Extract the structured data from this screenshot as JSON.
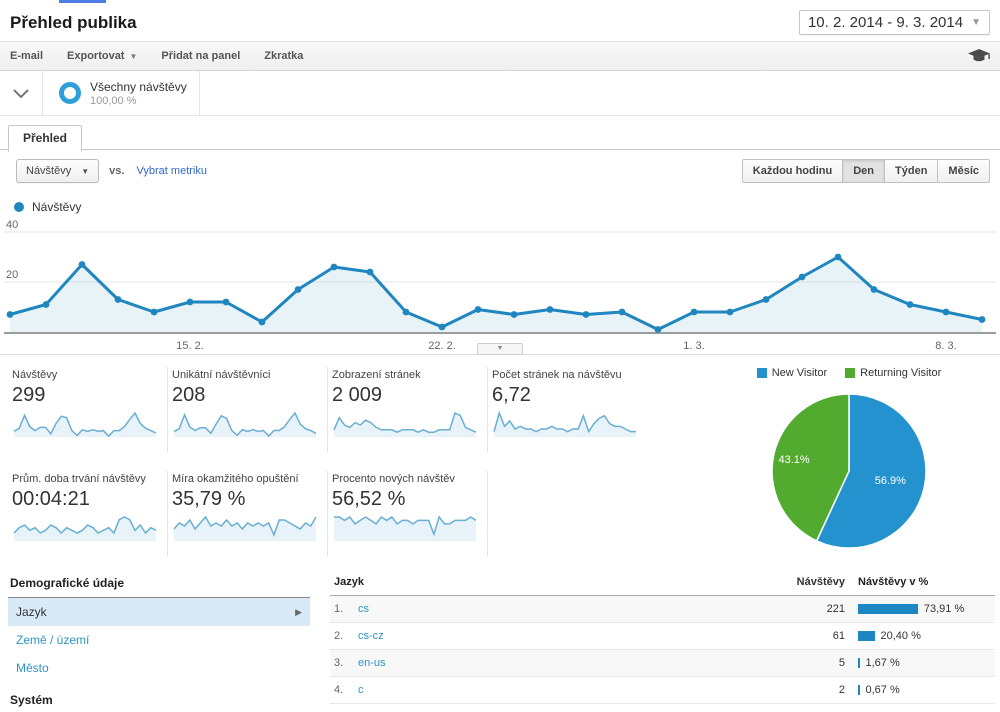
{
  "header": {
    "title": "Přehled publika",
    "date_range": "10. 2. 2014 - 9. 3. 2014"
  },
  "toolbar": {
    "items": [
      "E-mail",
      "Exportovat",
      "Přidat na panel",
      "Zkratka"
    ]
  },
  "segment": {
    "name": "Všechny návštěvy",
    "percent": "100,00 %"
  },
  "tabs": {
    "active": "Přehled"
  },
  "controls": {
    "metric_dropdown": "Návštěvy",
    "vs_label": "vs.",
    "select_metric": "Vybrat metriku",
    "granularity": [
      "Každou hodinu",
      "Den",
      "Týden",
      "Měsíc"
    ],
    "granularity_active": "Den"
  },
  "chart_data": {
    "type": "line",
    "title": "Návštěvy",
    "legend": "Návštěvy",
    "color": "#2086bf",
    "fill": "rgba(32,134,191,0.10)",
    "x": [
      "10.2.",
      "11.2.",
      "12.2.",
      "13.2.",
      "14.2.",
      "15.2.",
      "16.2.",
      "17.2.",
      "18.2.",
      "19.2.",
      "20.2.",
      "21.2.",
      "22.2.",
      "23.2.",
      "24.2.",
      "25.2.",
      "26.2.",
      "27.2.",
      "28.2.",
      "1.3.",
      "2.3.",
      "3.3.",
      "4.3.",
      "5.3.",
      "6.3.",
      "7.3.",
      "8.3.",
      "9.3."
    ],
    "values": [
      7,
      11,
      27,
      13,
      8,
      12,
      12,
      4,
      17,
      26,
      24,
      8,
      2,
      9,
      7,
      9,
      7,
      8,
      1,
      8,
      8,
      13,
      22,
      30,
      17,
      11,
      8,
      5
    ],
    "ylim": [
      0,
      44
    ],
    "y_gridlines": [
      20,
      40
    ],
    "x_tick_labels": [
      "15. 2.",
      "22. 2.",
      "1. 3.",
      "8. 3."
    ],
    "x_tick_indices": [
      5,
      12,
      19,
      26
    ],
    "grid": true,
    "legend_position": "top-left"
  },
  "cards": [
    {
      "label": "Návštěvy",
      "value": "299",
      "spark": [
        7,
        11,
        27,
        13,
        8,
        12,
        12,
        4,
        17,
        26,
        24,
        8,
        2,
        9,
        7,
        9,
        7,
        8,
        1,
        8,
        8,
        13,
        22,
        30,
        17,
        11,
        8,
        5
      ]
    },
    {
      "label": "Unikátní návštěvníci",
      "value": "208",
      "spark": [
        6,
        9,
        24,
        11,
        7,
        10,
        10,
        4,
        14,
        23,
        20,
        7,
        2,
        8,
        6,
        8,
        6,
        7,
        1,
        7,
        7,
        11,
        19,
        26,
        14,
        9,
        7,
        4
      ]
    },
    {
      "label": "Zobrazení stránek",
      "value": "2 009",
      "spark": [
        3,
        8,
        5,
        4,
        6,
        5,
        7,
        6,
        4,
        3,
        3,
        3,
        2,
        3,
        3,
        3,
        2,
        3,
        2,
        2,
        3,
        3,
        3,
        10,
        9,
        4,
        3,
        2
      ]
    },
    {
      "label": "Počet stránek na návštěvu",
      "value": "6,72",
      "spark": [
        2,
        9,
        4,
        6,
        3,
        4,
        3,
        3,
        2,
        3,
        3,
        4,
        3,
        3,
        2,
        3,
        3,
        8,
        2,
        5,
        7,
        8,
        5,
        4,
        4,
        3,
        2,
        2
      ]
    },
    {
      "label": "Prům. doba trvání návštěvy",
      "value": "00:04:21",
      "spark": [
        3,
        5,
        6,
        4,
        5,
        3,
        4,
        6,
        5,
        3,
        5,
        4,
        3,
        4,
        6,
        5,
        3,
        4,
        5,
        3,
        8,
        9,
        8,
        4,
        6,
        3,
        5,
        4
      ]
    },
    {
      "label": "Míra okamžitého opuštění",
      "value": "35,79 %",
      "spark": [
        4,
        6,
        5,
        7,
        4,
        6,
        8,
        5,
        6,
        5,
        7,
        5,
        6,
        4,
        6,
        5,
        6,
        5,
        6,
        2,
        7,
        7,
        6,
        5,
        4,
        6,
        5,
        8
      ]
    },
    {
      "label": "Procento nových návštěv",
      "value": "56,52 %",
      "spark": [
        7,
        7,
        6,
        7,
        5,
        6,
        7,
        6,
        5,
        7,
        6,
        7,
        5,
        6,
        6,
        5,
        6,
        6,
        6,
        2,
        7,
        5,
        5,
        6,
        6,
        6,
        7,
        6
      ]
    }
  ],
  "pie": {
    "type": "pie",
    "slices": [
      {
        "label": "New Visitor",
        "value": 56.9,
        "display": "56.9%",
        "color": "#2492cf"
      },
      {
        "label": "Returning Visitor",
        "value": 43.1,
        "display": "43.1%",
        "color": "#52ab2e"
      }
    ]
  },
  "sidebar": {
    "sections": [
      {
        "heading": "Demografické údaje",
        "items": [
          {
            "label": "Jazyk",
            "selected": true
          },
          {
            "label": "Země / území",
            "selected": false
          },
          {
            "label": "Město",
            "selected": false
          }
        ]
      },
      {
        "heading": "Systém",
        "items": []
      }
    ]
  },
  "table": {
    "columns": [
      "Jazyk",
      "Návštěvy",
      "Návštěvy v %"
    ],
    "rows": [
      {
        "index": "1.",
        "label": "cs",
        "visits": "221",
        "percent": "73,91 %",
        "pct": 73.91
      },
      {
        "index": "2.",
        "label": "cs-cz",
        "visits": "61",
        "percent": "20,40 %",
        "pct": 20.4
      },
      {
        "index": "3.",
        "label": "en-us",
        "visits": "5",
        "percent": "1,67 %",
        "pct": 1.67
      },
      {
        "index": "4.",
        "label": "c",
        "visits": "2",
        "percent": "0,67 %",
        "pct": 0.67
      }
    ]
  }
}
